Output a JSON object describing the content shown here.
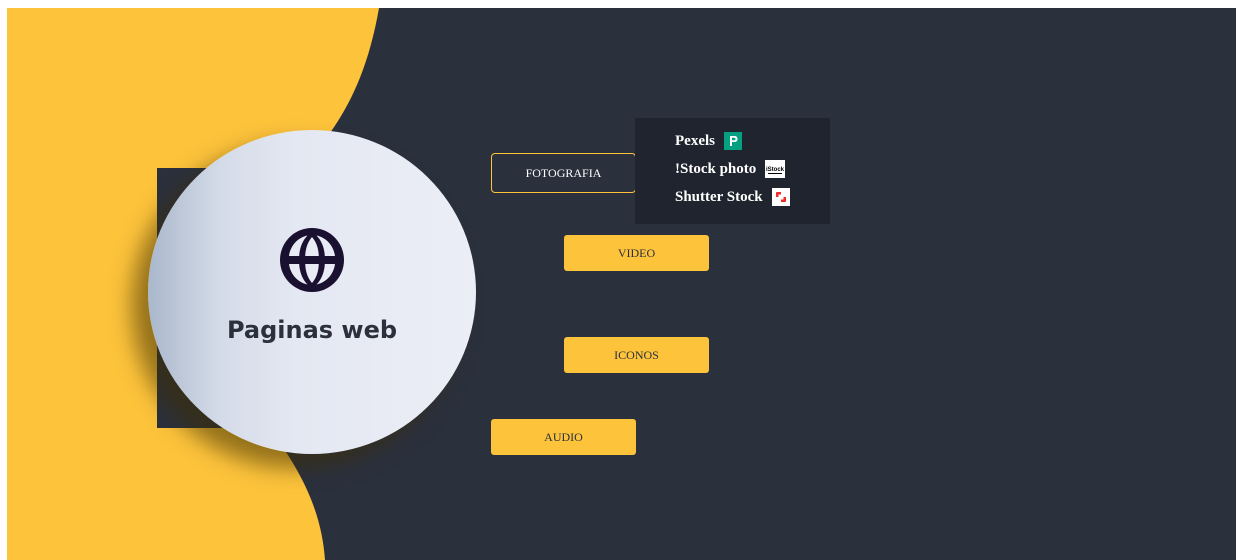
{
  "hero": {
    "title": "Paginas web",
    "icon": "globe-icon"
  },
  "menu": {
    "fotografia": "FOTOGRAFIA",
    "video": "VIDEO",
    "iconos": "ICONOS",
    "audio": "AUDIO"
  },
  "dropdown": {
    "items": [
      {
        "label": "Pexels",
        "icon": "pexels-logo-icon"
      },
      {
        "label": "!Stock photo",
        "icon": "istock-logo-icon"
      },
      {
        "label": "Shutter Stock",
        "icon": "shutterstock-logo-icon"
      }
    ],
    "istock_logo_text": "iStock"
  },
  "colors": {
    "accent": "#fdc33b",
    "background": "#2b303d",
    "dropdown_bg": "#1f242e",
    "hero_gradient_light": "#eceef6",
    "pexels_green": "#05a081",
    "shutterstock_red": "#ee2b24"
  }
}
